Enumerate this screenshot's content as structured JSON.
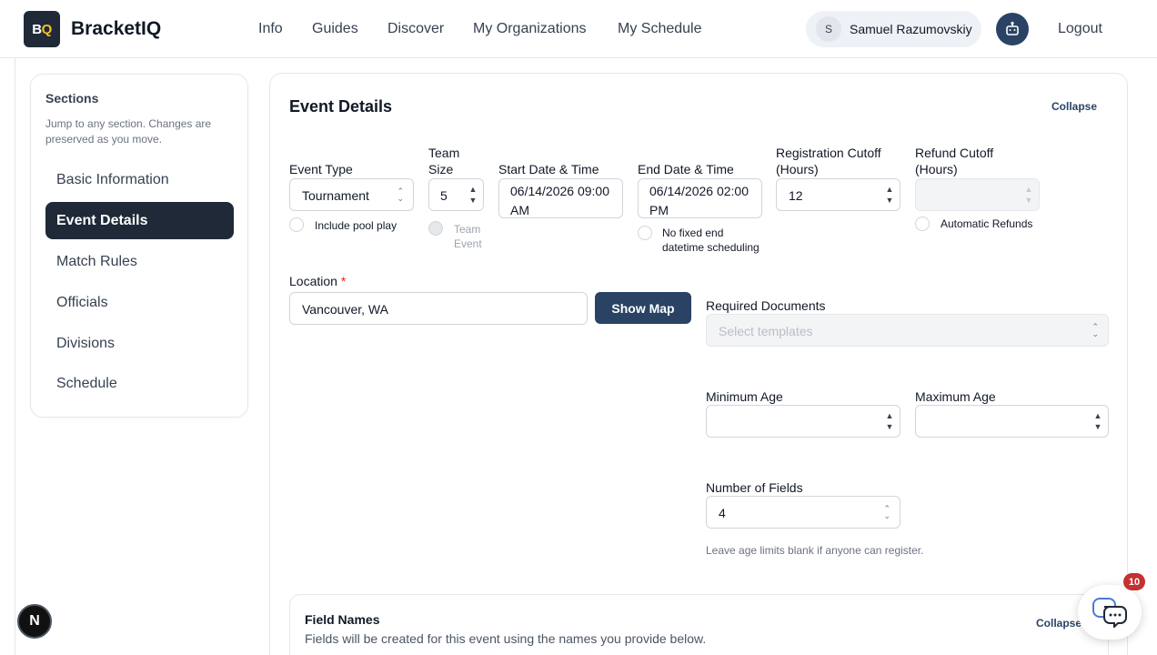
{
  "header": {
    "logo_text_a": "B",
    "logo_text_b": "Q",
    "brand": "BracketIQ",
    "nav": [
      "Info",
      "Guides",
      "Discover",
      "My Organizations",
      "My Schedule"
    ],
    "user_initial": "S",
    "user_name": "Samuel Razumovskiy",
    "logout": "Logout"
  },
  "sidebar": {
    "title": "Sections",
    "description": "Jump to any section. Changes are preserved as you move.",
    "items": [
      {
        "label": "Basic Information",
        "active": false
      },
      {
        "label": "Event Details",
        "active": true
      },
      {
        "label": "Match Rules",
        "active": false
      },
      {
        "label": "Officials",
        "active": false
      },
      {
        "label": "Divisions",
        "active": false
      },
      {
        "label": "Schedule",
        "active": false
      }
    ]
  },
  "event_details": {
    "title": "Event Details",
    "collapse": "Collapse",
    "event_type": {
      "label": "Event Type",
      "value": "Tournament"
    },
    "include_pool_play": "Include pool play",
    "team_size": {
      "label_1": "Team",
      "label_2": "Size",
      "value": "5"
    },
    "team_event": {
      "label_1": "Team",
      "label_2": "Event"
    },
    "start": {
      "label": "Start Date & Time",
      "value_1": "06/14/2026 09:00",
      "value_2": "AM"
    },
    "end": {
      "label": "End Date & Time",
      "value_1": "06/14/2026 02:00",
      "value_2": "PM"
    },
    "no_fixed_end": {
      "line_1": "No fixed end",
      "line_2": "datetime scheduling"
    },
    "reg_cutoff": {
      "label_1": "Registration Cutoff",
      "label_2": "(Hours)",
      "value": "12"
    },
    "refund_cutoff": {
      "label_1": "Refund Cutoff",
      "label_2": "(Hours)",
      "value": ""
    },
    "automatic_refunds": "Automatic Refunds",
    "location": {
      "label": "Location",
      "required_mark": "*",
      "value": "Vancouver, WA"
    },
    "show_map": "Show Map",
    "required_documents": {
      "label": "Required Documents",
      "placeholder": "Select templates"
    },
    "minimum_age": {
      "label": "Minimum Age",
      "value": ""
    },
    "maximum_age": {
      "label": "Maximum Age",
      "value": ""
    },
    "number_of_fields": {
      "label": "Number of Fields",
      "value": "4"
    },
    "age_hint": "Leave age limits blank if anyone can register."
  },
  "field_names": {
    "title": "Field Names",
    "description": "Fields will be created for this event using the names you provide below.",
    "collapse": "Collapse"
  },
  "floating": {
    "n_badge": "N",
    "chat_count": "10"
  },
  "colors": {
    "primary": "#2a4365",
    "active_nav": "#1f2937",
    "danger": "#c53030"
  }
}
